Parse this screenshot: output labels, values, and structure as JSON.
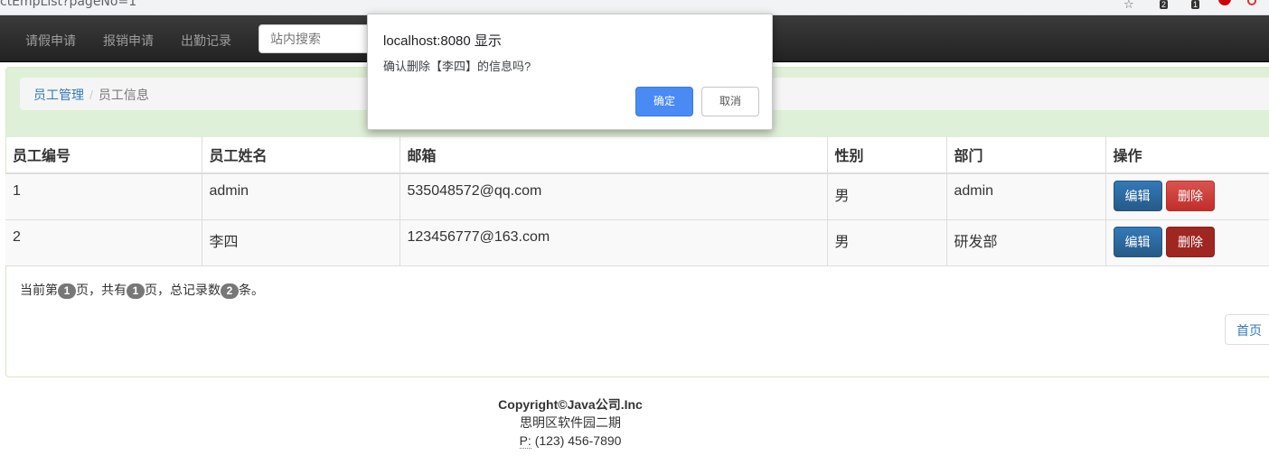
{
  "browser": {
    "url_fragment": "ctEmpList?pageNo=1",
    "ext_badges": [
      "2",
      "1"
    ]
  },
  "nav": {
    "items": [
      "请假申请",
      "报销申请",
      "出勤记录"
    ],
    "search_placeholder": "站内搜索"
  },
  "breadcrumb": {
    "parent": "员工管理",
    "separator": "/",
    "current": "员工信息"
  },
  "table": {
    "headers": [
      "员工编号",
      "员工姓名",
      "邮箱",
      "性别",
      "部门",
      "操作"
    ],
    "rows": [
      {
        "id": "1",
        "name": "admin",
        "email": "535048572@qq.com",
        "gender": "男",
        "dept": "admin"
      },
      {
        "id": "2",
        "name": "李四",
        "email": "123456777@163.com",
        "gender": "男",
        "dept": "研发部"
      }
    ],
    "edit_label": "编辑",
    "delete_label": "删除"
  },
  "pager": {
    "prefix": "当前第",
    "page": "1",
    "mid1": "页，共有",
    "total_pages": "1",
    "mid2": "页，总记录数",
    "total_records": "2",
    "suffix": "条。",
    "first_page_label": "首页"
  },
  "footer": {
    "copyright": "Copyright©Java公司.Inc",
    "address": "思明区软件园二期",
    "phone_label": "P:",
    "phone": "(123) 456-7890"
  },
  "dialog": {
    "title": "localhost:8080 显示",
    "message": "确认删除【李四】的信息吗?",
    "ok_label": "确定",
    "cancel_label": "取消"
  },
  "colors": {
    "navbar": "#222222",
    "panel_heading": "#dff0d8",
    "primary": "#337ab7",
    "danger": "#d9534f",
    "dialog_ok": "#4a8af4"
  }
}
